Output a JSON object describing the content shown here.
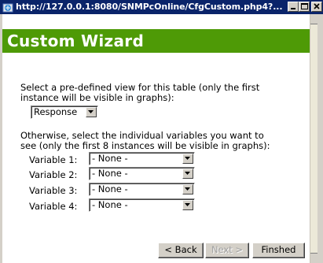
{
  "window": {
    "title": "http://127.0.0.1:8080/SNMPcOnline/CfgCustom.php4?...",
    "controls": [
      "minimize-icon",
      "maximize-icon",
      "close-icon"
    ],
    "title_bar_color": "#0a246a"
  },
  "header": {
    "title": "Custom Wizard",
    "background": "#4e9a06"
  },
  "predefined": {
    "text_line1": "Select a pre-defined view for this table (only the first",
    "text_line2": "instance will be visible in graphs):",
    "selected": "Response"
  },
  "individual": {
    "text_line1": "Otherwise, select the individual variables you want to",
    "text_line2": "see (only the first 8 instances will be visible in graphs):",
    "variables": [
      {
        "label": "Variable 1:",
        "value": "- None -"
      },
      {
        "label": "Variable 2:",
        "value": "- None -"
      },
      {
        "label": "Variable 3:",
        "value": "- None -"
      },
      {
        "label": "Variable 4:",
        "value": "- None -"
      }
    ]
  },
  "buttons": {
    "back": "< Back",
    "next": "Next >",
    "finish": "Finshed"
  }
}
